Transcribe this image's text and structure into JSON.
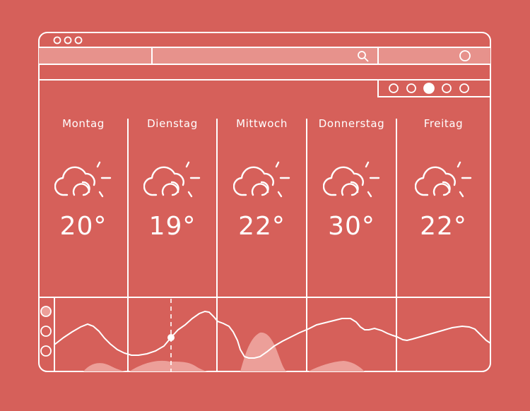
{
  "colors": {
    "background": "#d6605a",
    "line": "#ffffff",
    "field_fill": "#e7928c",
    "area_fill": "#ec9f99"
  },
  "window": {
    "traffic_lights": [
      "dot",
      "dot",
      "dot"
    ]
  },
  "toolbar": {
    "search_icon": "search-icon",
    "user_icon": "circle-icon"
  },
  "carousel": {
    "count": 5,
    "active_index": 2
  },
  "days": [
    {
      "label": "Montag",
      "temp": "20°",
      "icon": "partly-cloudy-icon"
    },
    {
      "label": "Dienstag",
      "temp": "19°",
      "icon": "partly-cloudy-icon"
    },
    {
      "label": "Mittwoch",
      "temp": "22°",
      "icon": "partly-cloudy-icon"
    },
    {
      "label": "Donnerstag",
      "temp": "30°",
      "icon": "partly-cloudy-icon"
    },
    {
      "label": "Freitag",
      "temp": "22°",
      "icon": "partly-cloudy-icon"
    }
  ],
  "graph_controls": {
    "buttons": 3,
    "active_index": 0
  }
}
